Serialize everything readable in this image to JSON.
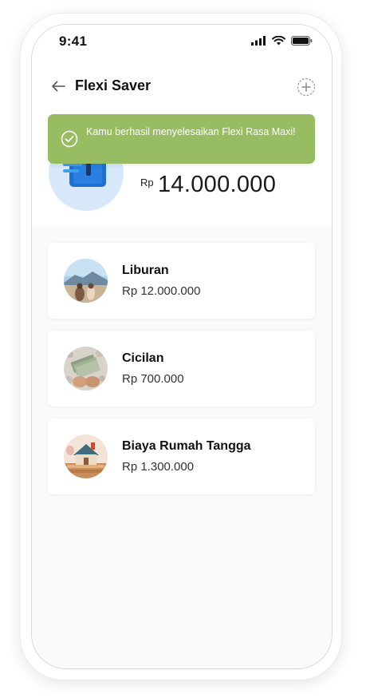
{
  "status_bar": {
    "time": "9:41",
    "icons": [
      "cellular-signal-icon",
      "wifi-icon",
      "battery-icon"
    ]
  },
  "header": {
    "title": "Flexi Saver",
    "back_icon": "arrow-left-icon",
    "add_icon": "add-circle-icon"
  },
  "balance": {
    "currency": "Rp",
    "amount": "14.000.000"
  },
  "toast": {
    "message": "Kamu berhasil menyelesaikan Flexi Rasa Maxi!",
    "icon": "check-circle-icon",
    "color": "#98bc62"
  },
  "pockets": [
    {
      "name": "Liburan",
      "amount": "Rp 12.000.000",
      "thumb": "vacation-photo"
    },
    {
      "name": "Cicilan",
      "amount": "Rp 700.000",
      "thumb": "money-photo"
    },
    {
      "name": "Biaya Rumah Tangga",
      "amount": "Rp 1.300.000",
      "thumb": "house-photo"
    }
  ],
  "colors": {
    "accent_blue": "#1e6fd0",
    "wallet_bg": "#d8e8fb"
  }
}
